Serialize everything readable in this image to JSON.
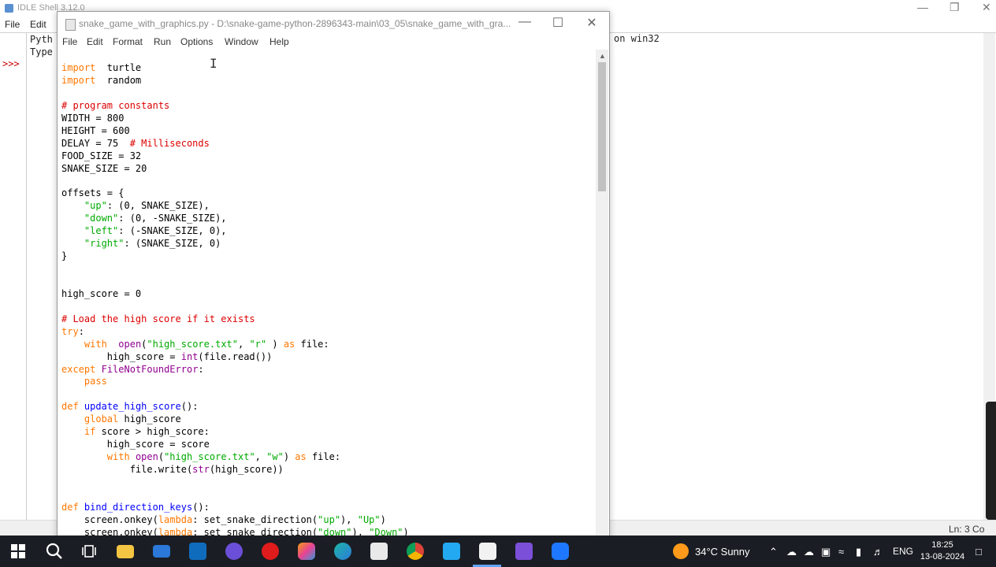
{
  "shell": {
    "title": "IDLE Shell 3.12.0",
    "menu": [
      "File",
      "Edit"
    ],
    "prompt": ">>>",
    "lines": [
      "Pyth",
      "Type"
    ],
    "right_text": "on win32",
    "status": "Ln: 3  Co"
  },
  "editor": {
    "title": "snake_game_with_graphics.py - D:\\snake-game-python-2896343-main\\03_05\\snake_game_with_gra...",
    "menu": [
      "File",
      "Edit",
      "Format",
      "Run",
      "Options",
      "Window",
      "Help"
    ]
  },
  "code": [
    [
      [
        "kw",
        "import"
      ],
      [
        "",
        "  turtle"
      ]
    ],
    [
      [
        "kw",
        "import"
      ],
      [
        "",
        "  random"
      ]
    ],
    [],
    [
      [
        "cm",
        "# program constants"
      ]
    ],
    [
      [
        "",
        "WIDTH = 800"
      ]
    ],
    [
      [
        "",
        "HEIGHT = 600"
      ]
    ],
    [
      [
        "",
        "DELAY = 75  "
      ],
      [
        "cm",
        "# Milliseconds"
      ]
    ],
    [
      [
        "",
        "FOOD_SIZE = 32"
      ]
    ],
    [
      [
        "",
        "SNAKE_SIZE = 20"
      ]
    ],
    [],
    [
      [
        "",
        "offsets = {"
      ]
    ],
    [
      [
        "",
        "    "
      ],
      [
        "st",
        "\"up\""
      ],
      [
        "",
        ": (0, SNAKE_SIZE),"
      ]
    ],
    [
      [
        "",
        "    "
      ],
      [
        "st",
        "\"down\""
      ],
      [
        "",
        ": (0, -SNAKE_SIZE),"
      ]
    ],
    [
      [
        "",
        "    "
      ],
      [
        "st",
        "\"left\""
      ],
      [
        "",
        ": (-SNAKE_SIZE, 0),"
      ]
    ],
    [
      [
        "",
        "    "
      ],
      [
        "st",
        "\"right\""
      ],
      [
        "",
        ": (SNAKE_SIZE, 0)"
      ]
    ],
    [
      [
        "",
        "}"
      ]
    ],
    [],
    [],
    [
      [
        "",
        "high_score = 0"
      ]
    ],
    [],
    [
      [
        "cm",
        "# Load the high score if it exists"
      ]
    ],
    [
      [
        "kw",
        "try"
      ],
      [
        "",
        ":"
      ]
    ],
    [
      [
        "",
        "    "
      ],
      [
        "kw",
        "with"
      ],
      [
        "",
        "  "
      ],
      [
        "bi",
        "open"
      ],
      [
        "",
        "("
      ],
      [
        "st",
        "\"high_score.txt\""
      ],
      [
        "",
        ", "
      ],
      [
        "st",
        "\"r\""
      ],
      [
        "",
        " ) "
      ],
      [
        "kw",
        "as"
      ],
      [
        "",
        " file:"
      ]
    ],
    [
      [
        "",
        "        high_score = "
      ],
      [
        "bi",
        "int"
      ],
      [
        "",
        "(file.read())"
      ]
    ],
    [
      [
        "kw",
        "except"
      ],
      [
        "",
        " "
      ],
      [
        "bi",
        "FileNotFoundError"
      ],
      [
        "",
        ":"
      ]
    ],
    [
      [
        "",
        "    "
      ],
      [
        "kw",
        "pass"
      ]
    ],
    [],
    [
      [
        "kw",
        "def"
      ],
      [
        "",
        " "
      ],
      [
        "df",
        "update_high_score"
      ],
      [
        "",
        "():"
      ]
    ],
    [
      [
        "",
        "    "
      ],
      [
        "kw",
        "global"
      ],
      [
        "",
        " high_score"
      ]
    ],
    [
      [
        "",
        "    "
      ],
      [
        "kw",
        "if"
      ],
      [
        "",
        " score > high_score:"
      ]
    ],
    [
      [
        "",
        "        high_score = score"
      ]
    ],
    [
      [
        "",
        "        "
      ],
      [
        "kw",
        "with"
      ],
      [
        "",
        " "
      ],
      [
        "bi",
        "open"
      ],
      [
        "",
        "("
      ],
      [
        "st",
        "\"high_score.txt\""
      ],
      [
        "",
        ", "
      ],
      [
        "st",
        "\"w\""
      ],
      [
        "",
        ") "
      ],
      [
        "kw",
        "as"
      ],
      [
        "",
        " file:"
      ]
    ],
    [
      [
        "",
        "            file.write("
      ],
      [
        "bi",
        "str"
      ],
      [
        "",
        "(high_score))"
      ]
    ],
    [],
    [],
    [
      [
        "kw",
        "def"
      ],
      [
        "",
        " "
      ],
      [
        "df",
        "bind_direction_keys"
      ],
      [
        "",
        "():"
      ]
    ],
    [
      [
        "",
        "    screen.onkey("
      ],
      [
        "kw",
        "lambda"
      ],
      [
        "",
        ": set_snake_direction("
      ],
      [
        "st",
        "\"up\""
      ],
      [
        "",
        "), "
      ],
      [
        "st",
        "\"Up\""
      ],
      [
        "",
        ")"
      ]
    ],
    [
      [
        "",
        "    screen.onkey("
      ],
      [
        "kw",
        "lambda"
      ],
      [
        "",
        ": set_snake_direction("
      ],
      [
        "st",
        "\"down\""
      ],
      [
        "",
        "), "
      ],
      [
        "st",
        "\"Down\""
      ],
      [
        "",
        ")"
      ]
    ]
  ],
  "taskbar": {
    "weather": "34°C  Sunny",
    "lang": "ENG",
    "time": "18:25",
    "date": "13-08-2024"
  }
}
